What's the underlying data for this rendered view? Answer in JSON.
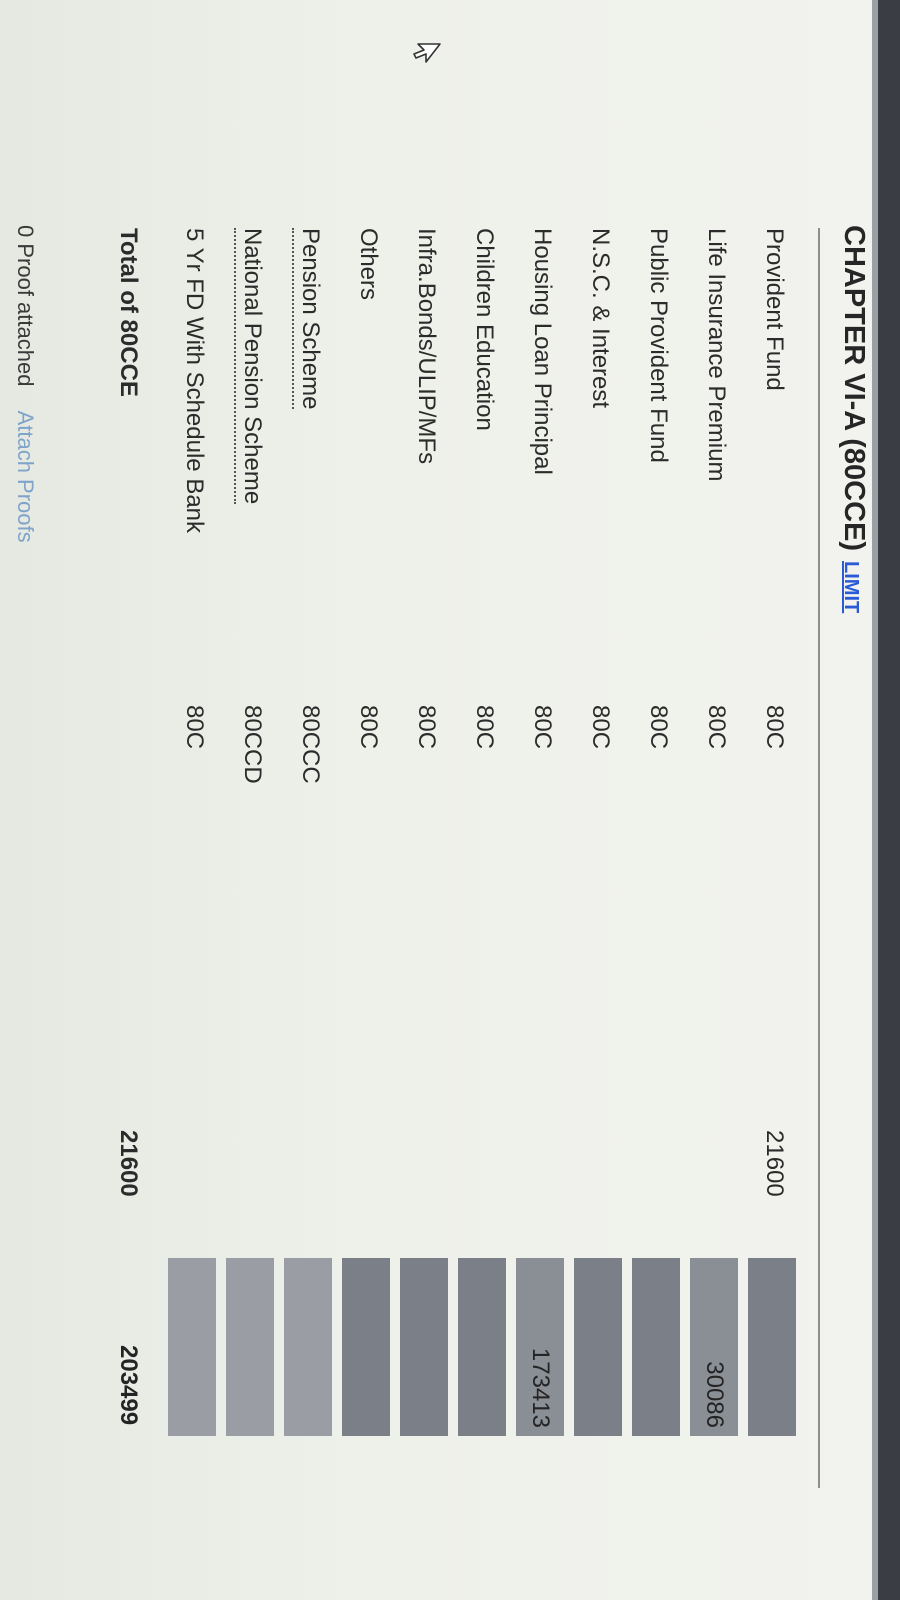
{
  "header": {
    "title": "CHAPTER VI-A (80CCE)",
    "limit_link": "LIMIT"
  },
  "rows": [
    {
      "label": "Provident Fund",
      "section": "80C",
      "amount": "21600",
      "box_value": ""
    },
    {
      "label": "Life Insurance Premium",
      "section": "80C",
      "amount": "",
      "box_value": "30086"
    },
    {
      "label": "Public Provident Fund",
      "section": "80C",
      "amount": "",
      "box_value": ""
    },
    {
      "label": "N.S.C. & Interest",
      "section": "80C",
      "amount": "",
      "box_value": ""
    },
    {
      "label": "Housing Loan Principal",
      "section": "80C",
      "amount": "",
      "box_value": "173413"
    },
    {
      "label": "Children Education",
      "section": "80C",
      "amount": "",
      "box_value": ""
    },
    {
      "label": "Infra.Bonds/ULIP/MFs",
      "section": "80C",
      "amount": "",
      "box_value": ""
    },
    {
      "label": "Others",
      "section": "80C",
      "amount": "",
      "box_value": ""
    },
    {
      "label": "Pension Scheme",
      "section": "80CCC",
      "amount": "",
      "box_value": ""
    },
    {
      "label": "National Pension Scheme",
      "section": "80CCD",
      "amount": "",
      "box_value": ""
    },
    {
      "label": "5 Yr FD With Schedule Bank",
      "section": "80C",
      "amount": "",
      "box_value": ""
    }
  ],
  "total": {
    "label": "Total of 80CCE",
    "amount": "21600",
    "grand_total": "203499"
  },
  "footer": {
    "proof_count": "0 Proof attached",
    "attach_link": "Attach Proofs"
  },
  "icons": {
    "cursor": "mouse-pointer-icon"
  }
}
